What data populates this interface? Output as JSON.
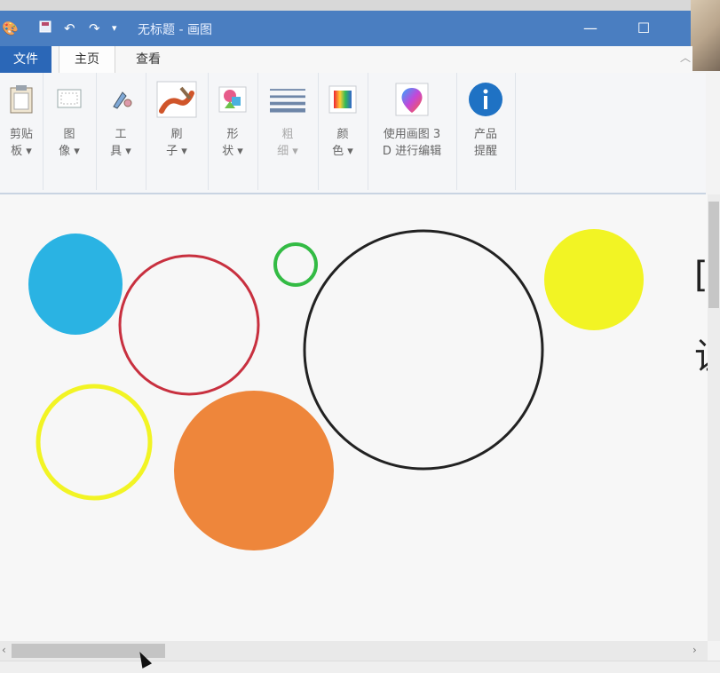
{
  "window": {
    "title": "无标题 - 画图",
    "minimize_glyph": "—",
    "maximize_glyph": "☐"
  },
  "quick_access": {
    "app_icon": "paint-brush-icon",
    "save_icon": "save-icon",
    "undo_icon": "undo-icon",
    "redo_icon": "redo-icon",
    "customize_glyph": "▾"
  },
  "tabs": {
    "file": "文件",
    "home": "主页",
    "view": "查看"
  },
  "ribbon": {
    "groups": [
      {
        "label": "剪贴\n板 ▾",
        "icon": "clipboard-icon"
      },
      {
        "label": "图\n像 ▾",
        "icon": "image-icon"
      },
      {
        "label": "工\n具 ▾",
        "icon": "tools-icon"
      },
      {
        "label": "刷\n子 ▾",
        "icon": "brush-icon"
      },
      {
        "label": "形\n状 ▾",
        "icon": "shapes-icon"
      },
      {
        "label": "粗\n细 ▾",
        "icon": "line-width-icon"
      },
      {
        "label": "颜\n色 ▾",
        "icon": "colors-icon"
      },
      {
        "label": "使用画图 3\nD 进行编辑",
        "icon": "paint3d-icon"
      },
      {
        "label": "产品\n提醒",
        "icon": "info-icon"
      }
    ]
  },
  "canvas": {
    "side_glyphs": [
      "[",
      "让"
    ]
  },
  "colors": {
    "titlebar": "#4a7ec1",
    "file_tab": "#2b67b7",
    "blue_fill": "#2ab3e3",
    "red_outline": "#c8303f",
    "green_outline": "#33bb44",
    "black_outline": "#222222",
    "yellow_fill": "#f2f424",
    "yellow_outline": "#f2f424",
    "orange_fill": "#ee863b"
  }
}
